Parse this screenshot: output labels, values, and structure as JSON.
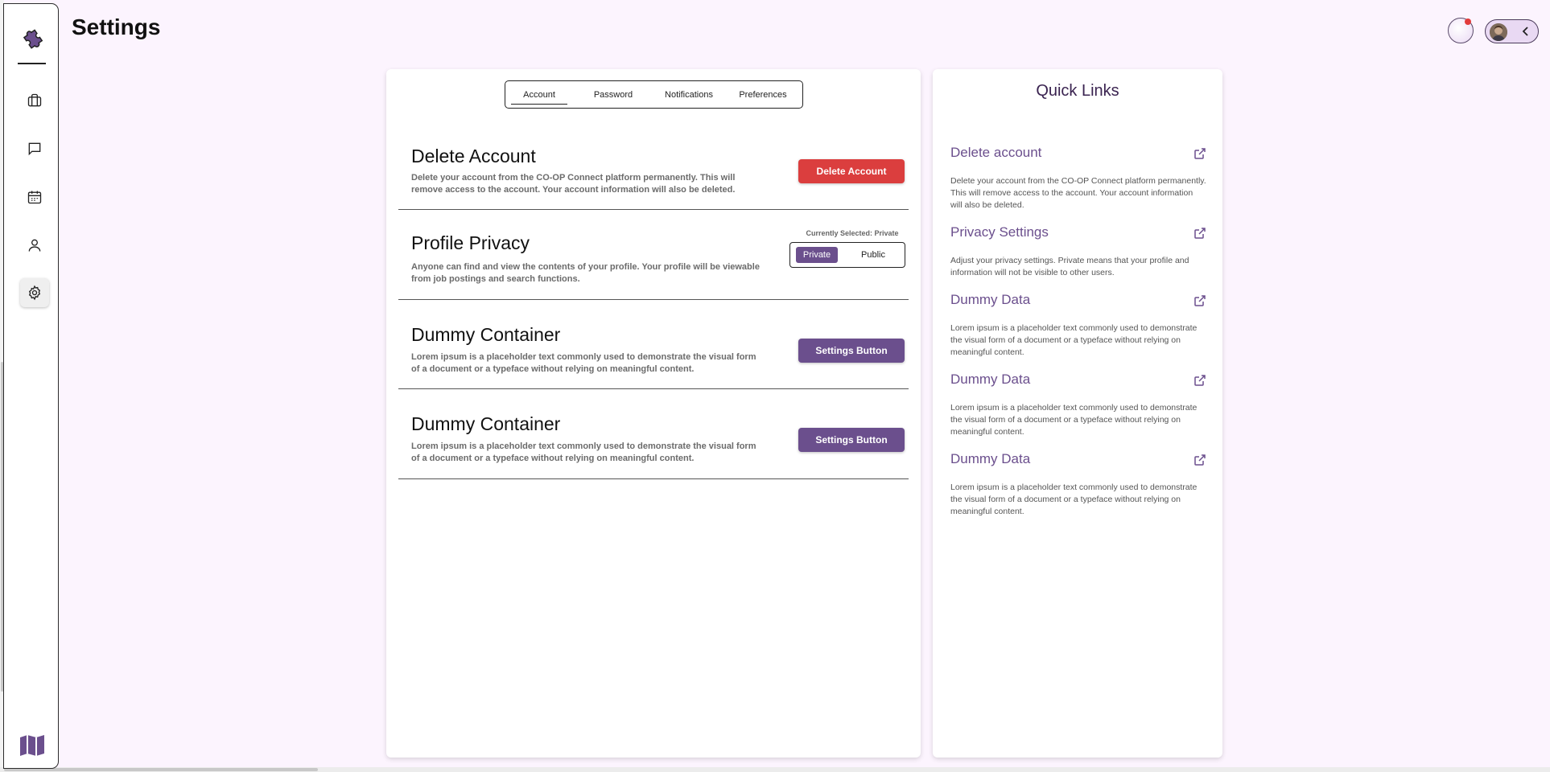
{
  "page": {
    "title": "Settings"
  },
  "sidebar": {
    "logo": "puzzle-logo-icon",
    "items": [
      {
        "icon": "briefcase-icon"
      },
      {
        "icon": "chat-icon"
      },
      {
        "icon": "calendar-icon"
      },
      {
        "icon": "user-icon"
      },
      {
        "icon": "gear-icon",
        "active": true
      }
    ],
    "footer_icon": "map-icon"
  },
  "header": {
    "notification_icon": "notification-bubble-icon",
    "profile_chevron": "chevron-left-icon"
  },
  "tabs": [
    {
      "label": "Account",
      "active": true
    },
    {
      "label": "Password"
    },
    {
      "label": "Notifications"
    },
    {
      "label": "Preferences"
    }
  ],
  "sections": {
    "delete": {
      "title": "Delete Account",
      "desc": "Delete your account from the CO-OP Connect platform permanently. This will remove access to the account. Your account information will also be deleted.",
      "button": "Delete Account"
    },
    "privacy": {
      "title": "Profile Privacy",
      "desc": "Anyone can find and view the contents of your profile. Your profile will be viewable from job postings and search functions.",
      "current": "Currently Selected: Private",
      "options": [
        "Private",
        "Public"
      ],
      "selected": "Private"
    },
    "dummy1": {
      "title": "Dummy Container",
      "desc": "Lorem ipsum is a placeholder text commonly used to demonstrate the visual form of a document or a typeface without relying on meaningful content.",
      "button": "Settings Button"
    },
    "dummy2": {
      "title": "Dummy Container",
      "desc": "Lorem ipsum is a placeholder text commonly used to demonstrate the visual form of a document or a typeface without relying on meaningful content.",
      "button": "Settings Button"
    }
  },
  "quick_links": {
    "title": "Quick Links",
    "items": [
      {
        "title": "Delete account",
        "desc": "Delete your account from the CO-OP Connect platform permanently. This will remove access to the account. Your account information will also be deleted."
      },
      {
        "title": "Privacy Settings",
        "desc": "Adjust your privacy settings. Private means that your profile and information will not be visible to other users."
      },
      {
        "title": "Dummy Data",
        "desc": "Lorem ipsum is a placeholder text commonly used to demonstrate the visual form of a document or a typeface without relying on meaningful content."
      },
      {
        "title": "Dummy Data",
        "desc": "Lorem ipsum is a placeholder text commonly used to demonstrate the visual form of a document or a typeface without relying on meaningful content."
      },
      {
        "title": "Dummy Data",
        "desc": "Lorem ipsum is a placeholder text commonly used to demonstrate the visual form of a document or a typeface without relying on meaningful content."
      }
    ],
    "link_icon": "external-link-icon"
  },
  "colors": {
    "accent": "#6b4f8d",
    "danger": "#db3e3e",
    "background": "#fcf4fe"
  }
}
